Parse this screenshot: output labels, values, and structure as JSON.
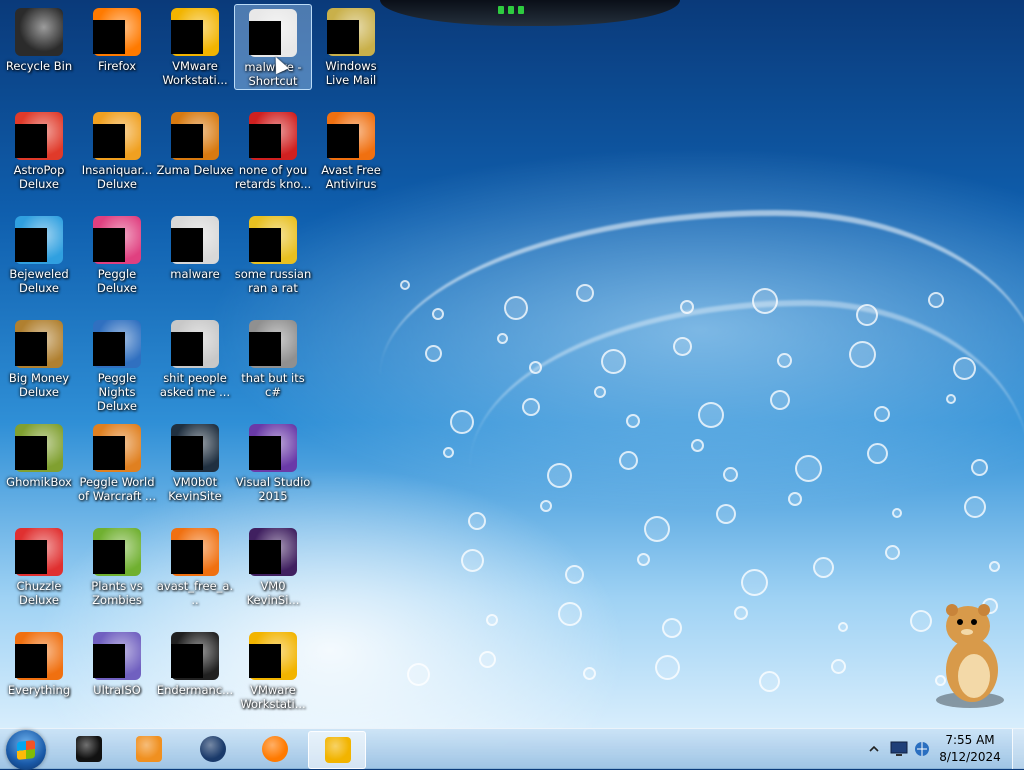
{
  "desktop": {
    "icons": [
      {
        "label": "Recycle Bin",
        "color": "#2b2b2b"
      },
      {
        "label": "Firefox",
        "color": "#ff7a00"
      },
      {
        "label": "VMware Workstati...",
        "color": "#f2b400"
      },
      {
        "label": "malware - Shortcut",
        "color": "#e8e8e8"
      },
      {
        "label": "Windows Live Mail",
        "color": "#c9b04a"
      },
      {
        "label": "AstroPop Deluxe",
        "color": "#e03a2a"
      },
      {
        "label": "Insaniquar... Deluxe",
        "color": "#f0a020"
      },
      {
        "label": "Zuma Deluxe",
        "color": "#d87a10"
      },
      {
        "label": "none of you retards kno...",
        "color": "#d02020"
      },
      {
        "label": "Avast Free Antivirus",
        "color": "#f07010"
      },
      {
        "label": "Bejeweled Deluxe",
        "color": "#30a0e0"
      },
      {
        "label": "Peggle Deluxe",
        "color": "#e04080"
      },
      {
        "label": "malware",
        "color": "#d8d8d8"
      },
      {
        "label": "some russian ran a rat",
        "color": "#e8c020"
      },
      {
        "label": "Big Money Deluxe",
        "color": "#b08030"
      },
      {
        "label": "Peggle Nights Deluxe",
        "color": "#3070c0"
      },
      {
        "label": "shit people asked me ...",
        "color": "#c8c8c8"
      },
      {
        "label": "that but its c#",
        "color": "#909090"
      },
      {
        "label": "GhomikBox",
        "color": "#80a030"
      },
      {
        "label": "Peggle World of Warcraft ...",
        "color": "#e08020"
      },
      {
        "label": "VM0b0t KevinSite",
        "color": "#203040"
      },
      {
        "label": "Visual Studio 2015",
        "color": "#6a3aa8"
      },
      {
        "label": "Chuzzle Deluxe",
        "color": "#e03030"
      },
      {
        "label": "Plants vs Zombies",
        "color": "#70b030"
      },
      {
        "label": "avast_free_a...",
        "color": "#f07010"
      },
      {
        "label": "VM0 KevinSi...",
        "color": "#402060"
      },
      {
        "label": "Everything",
        "color": "#f07010"
      },
      {
        "label": "UltraISO",
        "color": "#7060c0"
      },
      {
        "label": "Endermanc...",
        "color": "#202020"
      },
      {
        "label": "VMware Workstati...",
        "color": "#f2b400"
      }
    ],
    "selected_index": 3
  },
  "taskbar": {
    "start_icon": "windows-start-icon",
    "pinned": [
      {
        "name": "terminal-icon",
        "color": "#111111"
      },
      {
        "name": "media-player-icon",
        "color": "#f09020"
      },
      {
        "name": "globe-icon",
        "color": "#1a3a6a"
      },
      {
        "name": "firefox-icon",
        "color": "#ff7a00"
      },
      {
        "name": "vmware-icon",
        "color": "#f2b400"
      }
    ],
    "active_index": 4,
    "tray": {
      "icons": [
        "chevron-up-icon",
        "monitor-icon",
        "network-icon"
      ],
      "time": "7:55 AM",
      "date": "8/12/2024"
    }
  }
}
